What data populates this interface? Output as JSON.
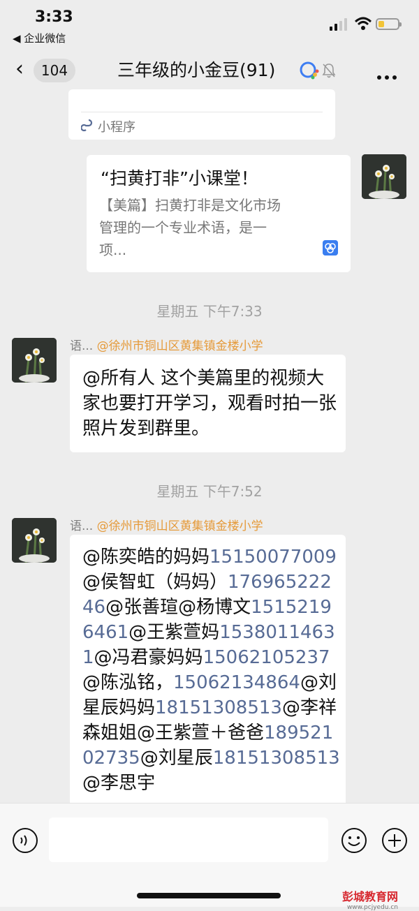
{
  "status_bar": {
    "time": "3:33",
    "back_app": "◀ 企业微信"
  },
  "nav": {
    "back_count": "104",
    "title": "三年级的小金豆",
    "member_count": "(91)"
  },
  "mini_card": {
    "label": "小程序"
  },
  "article_card": {
    "title": "“扫黄打非”小课堂！",
    "description": "【美篇】扫黄打非是文化市场管理的一个专业术语，是一项..."
  },
  "messages": [
    {
      "timestamp": "星期五 下午7:33",
      "sender_name": "语...",
      "sender_org": "@徐州市铜山区黄集镇金楼小学",
      "text": "@所有人 这个美篇里的视频大家也要打开学习，观看时拍一张照片发到群里。"
    },
    {
      "timestamp": "星期五 下午7:52",
      "sender_name": "语...",
      "sender_org": "@徐州市铜山区黄集镇金楼小学",
      "segments": [
        {
          "t": "@陈奕皓的妈妈",
          "phone": false
        },
        {
          "t": "15150077009",
          "phone": true
        },
        {
          "t": "@侯智虹（妈妈）",
          "phone": false
        },
        {
          "t": "17696522246",
          "phone": true
        },
        {
          "t": "@张善瑄@杨博文",
          "phone": false
        },
        {
          "t": "15152196461",
          "phone": true
        },
        {
          "t": "@王紫萱妈",
          "phone": false
        },
        {
          "t": "15380114631",
          "phone": true
        },
        {
          "t": "@冯君豪妈妈",
          "phone": false
        },
        {
          "t": "15062105237",
          "phone": true
        },
        {
          "t": "@陈泓铭，",
          "phone": false
        },
        {
          "t": "15062134864",
          "phone": true
        },
        {
          "t": "@刘星辰妈妈",
          "phone": false
        },
        {
          "t": "18151308513",
          "phone": true
        },
        {
          "t": "@李祥森姐姐@王紫萱＋爸爸",
          "phone": false
        },
        {
          "t": "18952102735",
          "phone": true
        },
        {
          "t": "@刘星辰",
          "phone": false
        },
        {
          "t": "18151308513",
          "phone": true
        },
        {
          "t": "@李思宇",
          "phone": false
        }
      ]
    }
  ],
  "watermark": {
    "name": "彭城教育网",
    "url": "www.pcjyedu.cn"
  },
  "colors": {
    "background": "#ededed",
    "link_phone": "#576b95",
    "org_tag": "#e59a3a",
    "timestamp": "#a2a2a2"
  }
}
